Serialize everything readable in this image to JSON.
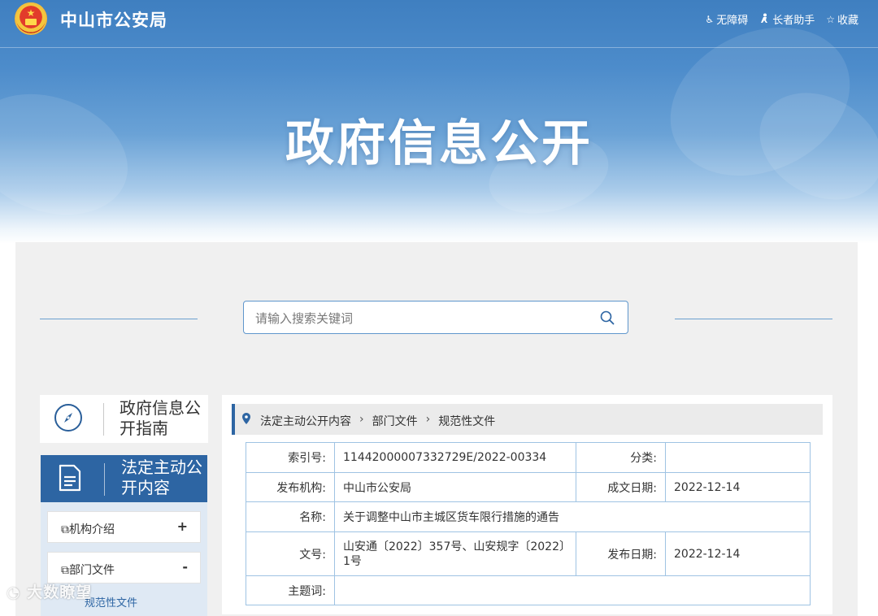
{
  "header": {
    "site_title": "中山市公安局",
    "tools": [
      {
        "label": "无障碍",
        "icon": "accessibility-icon"
      },
      {
        "label": "长者助手",
        "icon": "elder-assist-icon"
      },
      {
        "label": "收藏",
        "icon": "star-icon"
      }
    ],
    "hero_title": "政府信息公开"
  },
  "search": {
    "placeholder": "请输入搜索关键词",
    "value": ""
  },
  "sidebar": {
    "guide_label": "政府信息公开指南",
    "active_label": "法定主动公开内容",
    "items": [
      {
        "label": "机构介绍",
        "sign": "+"
      },
      {
        "label": "部门文件",
        "sign": "-"
      }
    ],
    "subitems": [
      "规范性文件"
    ]
  },
  "breadcrumb": [
    "法定主动公开内容",
    "部门文件",
    "规范性文件"
  ],
  "detail": {
    "index_label": "索引号:",
    "index_value": "11442000007332729E/2022-00334",
    "category_label": "分类:",
    "category_value": "",
    "publisher_label": "发布机构:",
    "publisher_value": "中山市公安局",
    "written_date_label": "成文日期:",
    "written_date_value": "2022-12-14",
    "name_label": "名称:",
    "name_value": "关于调整中山市主城区货车限行措施的通告",
    "doc_no_label": "文号:",
    "doc_no_value": "山安通〔2022〕357号、山安规字〔2022〕1号",
    "publish_date_label": "发布日期:",
    "publish_date_value": "2022-12-14",
    "keywords_label": "主题词:",
    "keywords_value": ""
  },
  "watermark": "大数瞭望",
  "colors": {
    "brand_blue": "#2d65a3",
    "border_blue": "#9fc3e3",
    "panel_gray": "#f0f0f0"
  }
}
